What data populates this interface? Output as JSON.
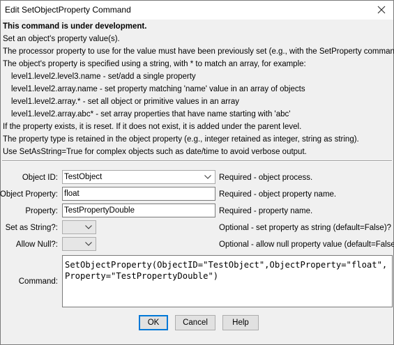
{
  "window": {
    "title": "Edit SetObjectProperty Command"
  },
  "description": [
    {
      "text": "This command is under development.",
      "style": "bold"
    },
    {
      "text": "Set an object's property value(s).",
      "style": "normal"
    },
    {
      "text": "The processor property to use for the value must have been previously set (e.g., with the SetProperty command).",
      "style": "normal"
    },
    {
      "text": "The object's property is specified using a string, with * to match an array, for example:",
      "style": "normal"
    },
    {
      "text": "level1.level2.level3.name - set/add a single property",
      "style": "indent"
    },
    {
      "text": "level1.level2.array.name - set property matching 'name' value in an array of objects",
      "style": "indent"
    },
    {
      "text": "level1.level2.array.* - set all object or primitive values in an array",
      "style": "indent"
    },
    {
      "text": "level1.level2.array.abc* - set array properties that have name starting with 'abc'",
      "style": "indent"
    },
    {
      "text": "If the property exists, it is reset.  If it does not exist, it is added under the parent level.",
      "style": "normal"
    },
    {
      "text": "The property type is retained in the object property (e.g., integer retained as integer, string as string).",
      "style": "normal"
    },
    {
      "text": "Use SetAsString=True for complex objects such as date/time to avoid verbose output.",
      "style": "normal"
    }
  ],
  "form": {
    "object_id": {
      "label": "Object ID:",
      "value": "TestObject",
      "hint": "Required - object process."
    },
    "object_property": {
      "label": "Object Property:",
      "value": "float",
      "hint": "Required - object property name."
    },
    "property": {
      "label": "Property:",
      "value": "TestPropertyDouble",
      "hint": "Required - property name."
    },
    "set_as_string": {
      "label": "Set as String?:",
      "value": "",
      "hint": "Optional - set property as string (default=False)?"
    },
    "allow_null": {
      "label": "Allow Null?:",
      "value": "",
      "hint": "Optional - allow null property value (default=False)?"
    },
    "command": {
      "label": "Command:",
      "value": "SetObjectProperty(ObjectID=\"TestObject\",ObjectProperty=\"float\",Property=\"TestPropertyDouble\")"
    }
  },
  "buttons": {
    "ok": "OK",
    "cancel": "Cancel",
    "help": "Help"
  },
  "icons": {
    "close": "close-icon",
    "dropdown": "chevron-down-icon"
  }
}
